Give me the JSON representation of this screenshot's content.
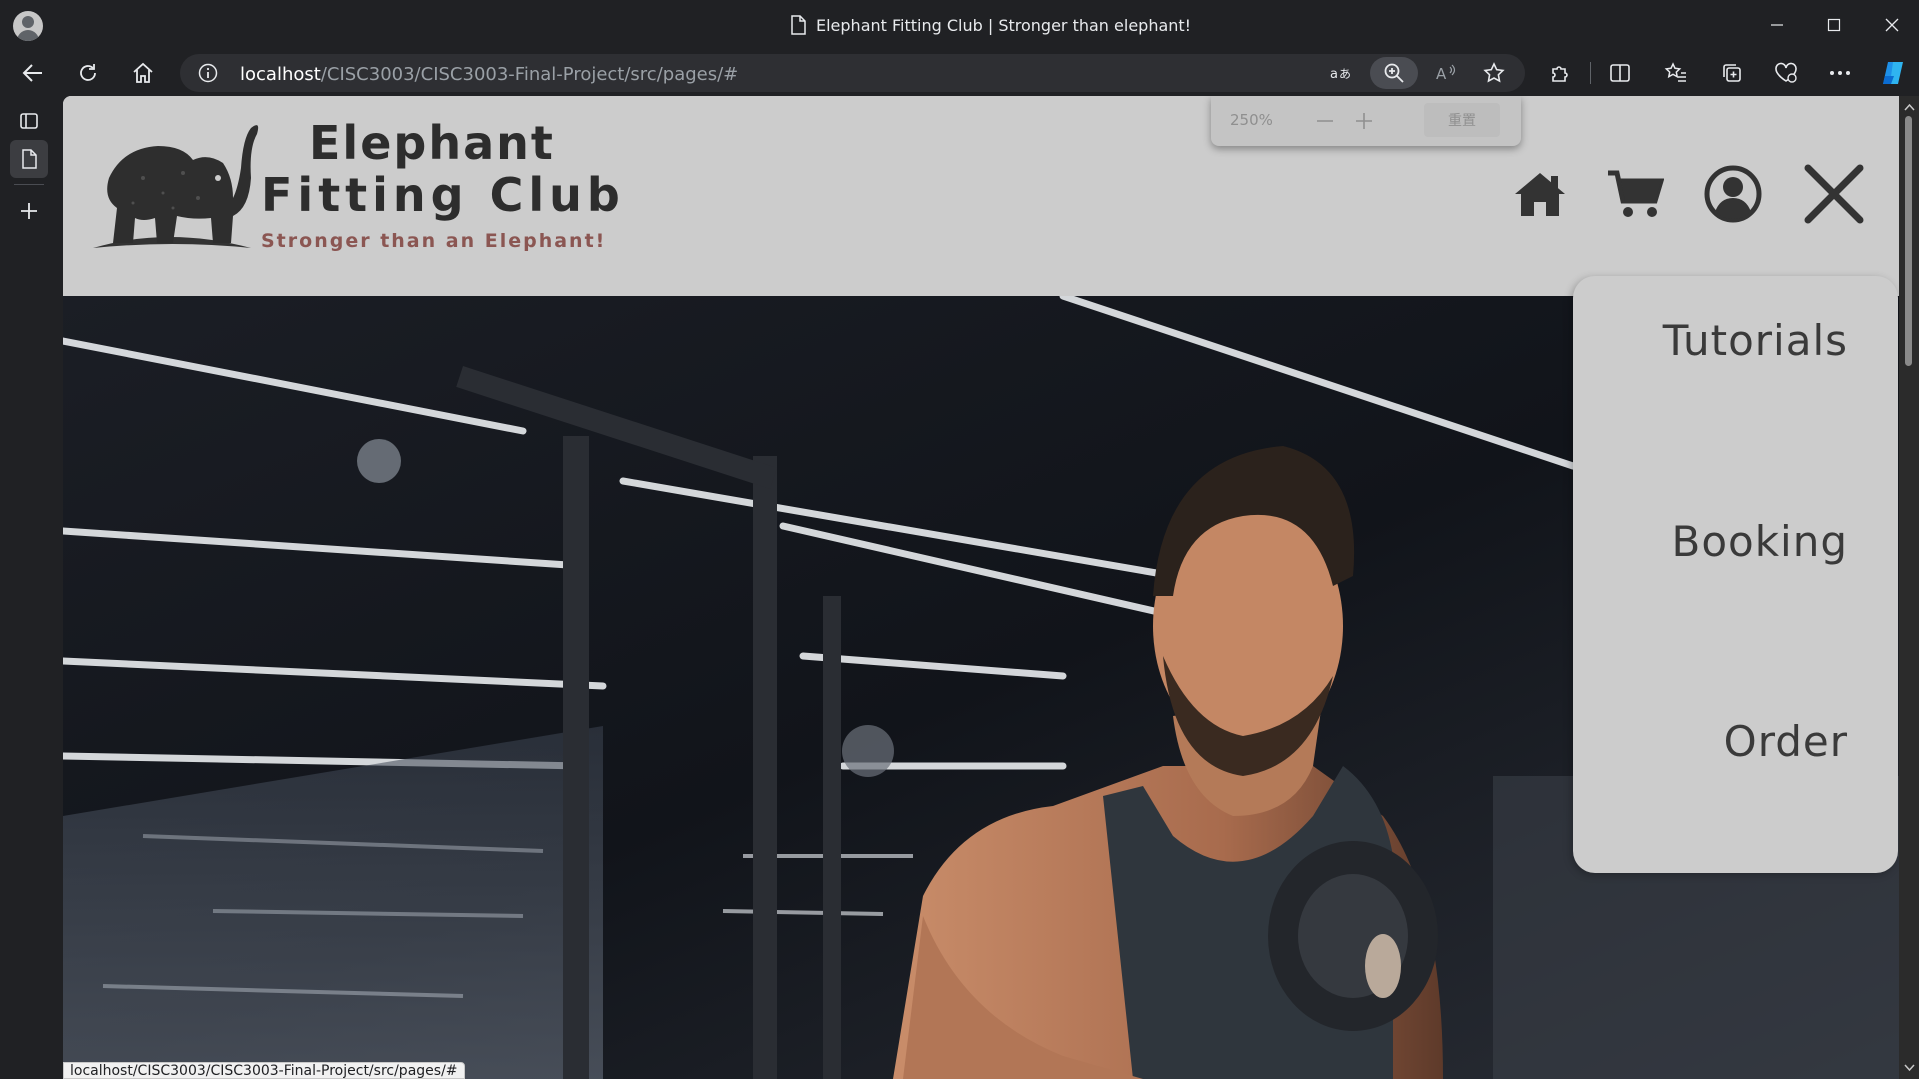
{
  "window": {
    "title": "Elephant Fitting Club | Stronger than elephant!",
    "controls": [
      "minimize",
      "maximize",
      "close"
    ]
  },
  "toolbar": {
    "url_host": "localhost",
    "url_path": "/CISC3003/CISC3003-Final-Project/src/pages/#"
  },
  "zoom_popup": {
    "level": "250%",
    "reset_label": "重置"
  },
  "site": {
    "brand_line1": "Elephant",
    "brand_line2": "Fitting Club",
    "tagline": "Stronger than an Elephant!",
    "nav_icons": [
      "home-icon",
      "cart-icon",
      "user-icon",
      "close-icon"
    ],
    "menu": {
      "items": [
        {
          "label": "Tutorials"
        },
        {
          "label": "Booking"
        },
        {
          "label": "Order"
        }
      ]
    }
  },
  "status_bar": {
    "url": "localhost/CISC3003/CISC3003-Final-Project/src/pages/#"
  },
  "colors": {
    "header_bg": "#cccccc",
    "brand_text": "#2d2d2d",
    "tagline": "#8b5652",
    "browser_chrome": "#202124"
  }
}
